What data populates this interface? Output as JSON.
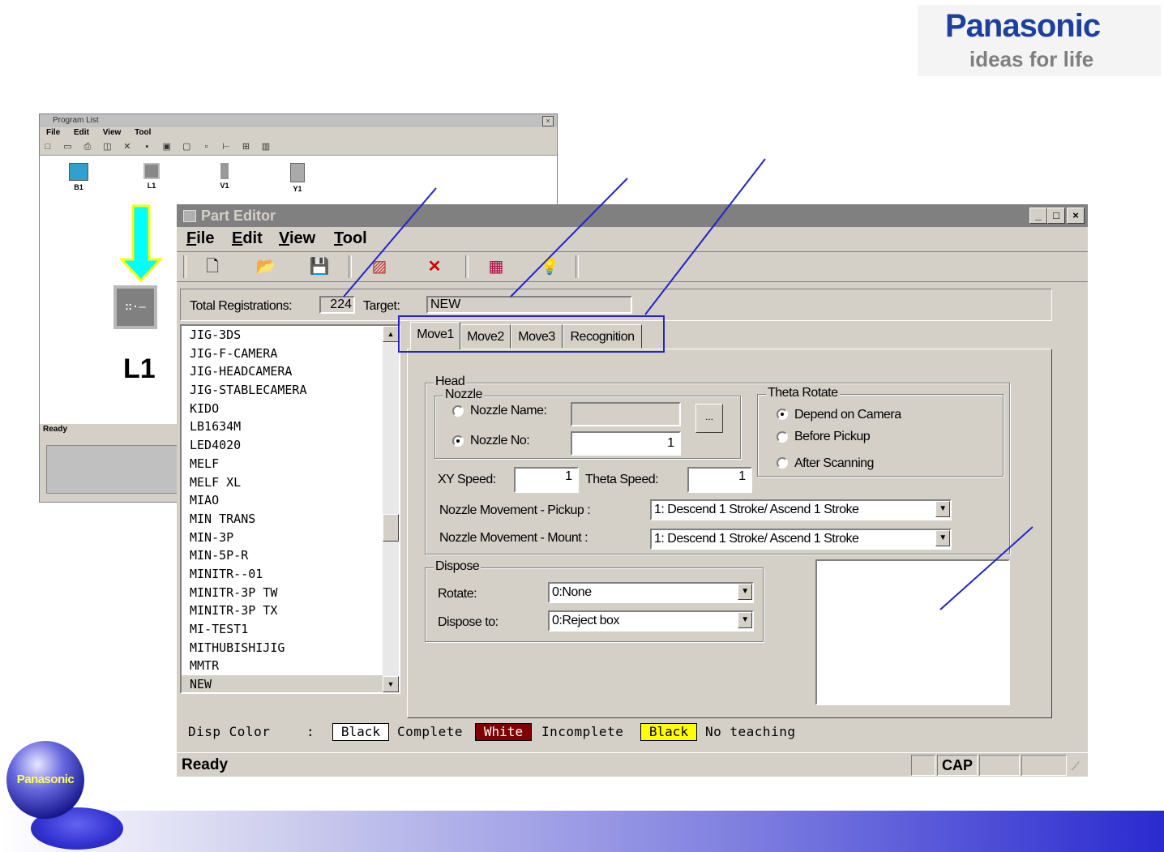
{
  "brand": {
    "name": "Panasonic",
    "tagline": "ideas for life",
    "ball_text": "Panasonic"
  },
  "program_list": {
    "title": "Program List",
    "menu": [
      "File",
      "Edit",
      "View",
      "Tool"
    ],
    "parts": [
      "B1",
      "L1",
      "V1",
      "Y1"
    ],
    "status": "Ready",
    "selected_part_label": "L1"
  },
  "part_editor": {
    "title": "Part Editor",
    "menu": [
      "File",
      "Edit",
      "View",
      "Tool"
    ],
    "toolbar_icons": [
      "new-icon",
      "open-icon",
      "save-icon",
      "image-icon",
      "delete-icon",
      "register-icon",
      "bulb-icon"
    ],
    "total_registrations_label": "Total Registrations:",
    "total_registrations_value": "224",
    "target_label": "Target:",
    "target_value": "NEW",
    "part_list": [
      "JIG-3DS",
      "JIG-F-CAMERA",
      "JIG-HEADCAMERA",
      "JIG-STABLECAMERA",
      "KIDO",
      "LB1634M",
      "LED4020",
      "MELF",
      "MELF XL",
      "MIAO",
      "MIN TRANS",
      "MIN-3P",
      "MIN-5P-R",
      "MINITR--01",
      "MINITR-3P TW",
      "MINITR-3P TX",
      "MI-TEST1",
      "MITHUBISHIJIG",
      "MMTR",
      "NEW"
    ],
    "tabs": [
      "Move1",
      "Move2",
      "Move3",
      "Recognition"
    ],
    "active_tab": "Move1",
    "head_group": "Head",
    "nozzle_group": "Nozzle",
    "nozzle_name_label": "Nozzle Name:",
    "nozzle_name_value": "",
    "nozzle_browse": "...",
    "nozzle_no_label": "Nozzle No:",
    "nozzle_no_value": "1",
    "nozzle_mode": "Nozzle No",
    "theta_group": "Theta Rotate",
    "theta_options": [
      "Depend on Camera",
      "Before Pickup",
      "After Scanning"
    ],
    "theta_selected": "Depend on Camera",
    "xy_speed_label": "XY Speed:",
    "xy_speed_value": "1",
    "theta_speed_label": "Theta Speed:",
    "theta_speed_value": "1",
    "pickup_label": "Nozzle Movement - Pickup :",
    "pickup_value": "1: Descend 1 Stroke/ Ascend 1 Stroke",
    "mount_label": "Nozzle Movement - Mount :",
    "mount_value": "1: Descend 1 Stroke/ Ascend 1 Stroke",
    "dispose_group": "Dispose",
    "rotate_label": "Rotate:",
    "rotate_value": "0:None",
    "dispose_to_label": "Dispose to:",
    "dispose_to_value": "0:Reject box",
    "legend": {
      "label": "Disp Color",
      "colon": ":",
      "items": [
        {
          "swatch": "Black",
          "text": "Complete",
          "bg": "#ffffff",
          "fg": "#000000"
        },
        {
          "swatch": "White",
          "text": "Incomplete",
          "bg": "#800000",
          "fg": "#ffffff"
        },
        {
          "swatch": "Black",
          "text": "No teaching",
          "bg": "#ffff00",
          "fg": "#000000"
        }
      ]
    },
    "status": "Ready",
    "status_panes": [
      "",
      "CAP",
      "",
      ""
    ]
  },
  "colors": {
    "brand": "#1d3f9e",
    "annotation": "#2323c8",
    "arrow": "#00ffff"
  }
}
